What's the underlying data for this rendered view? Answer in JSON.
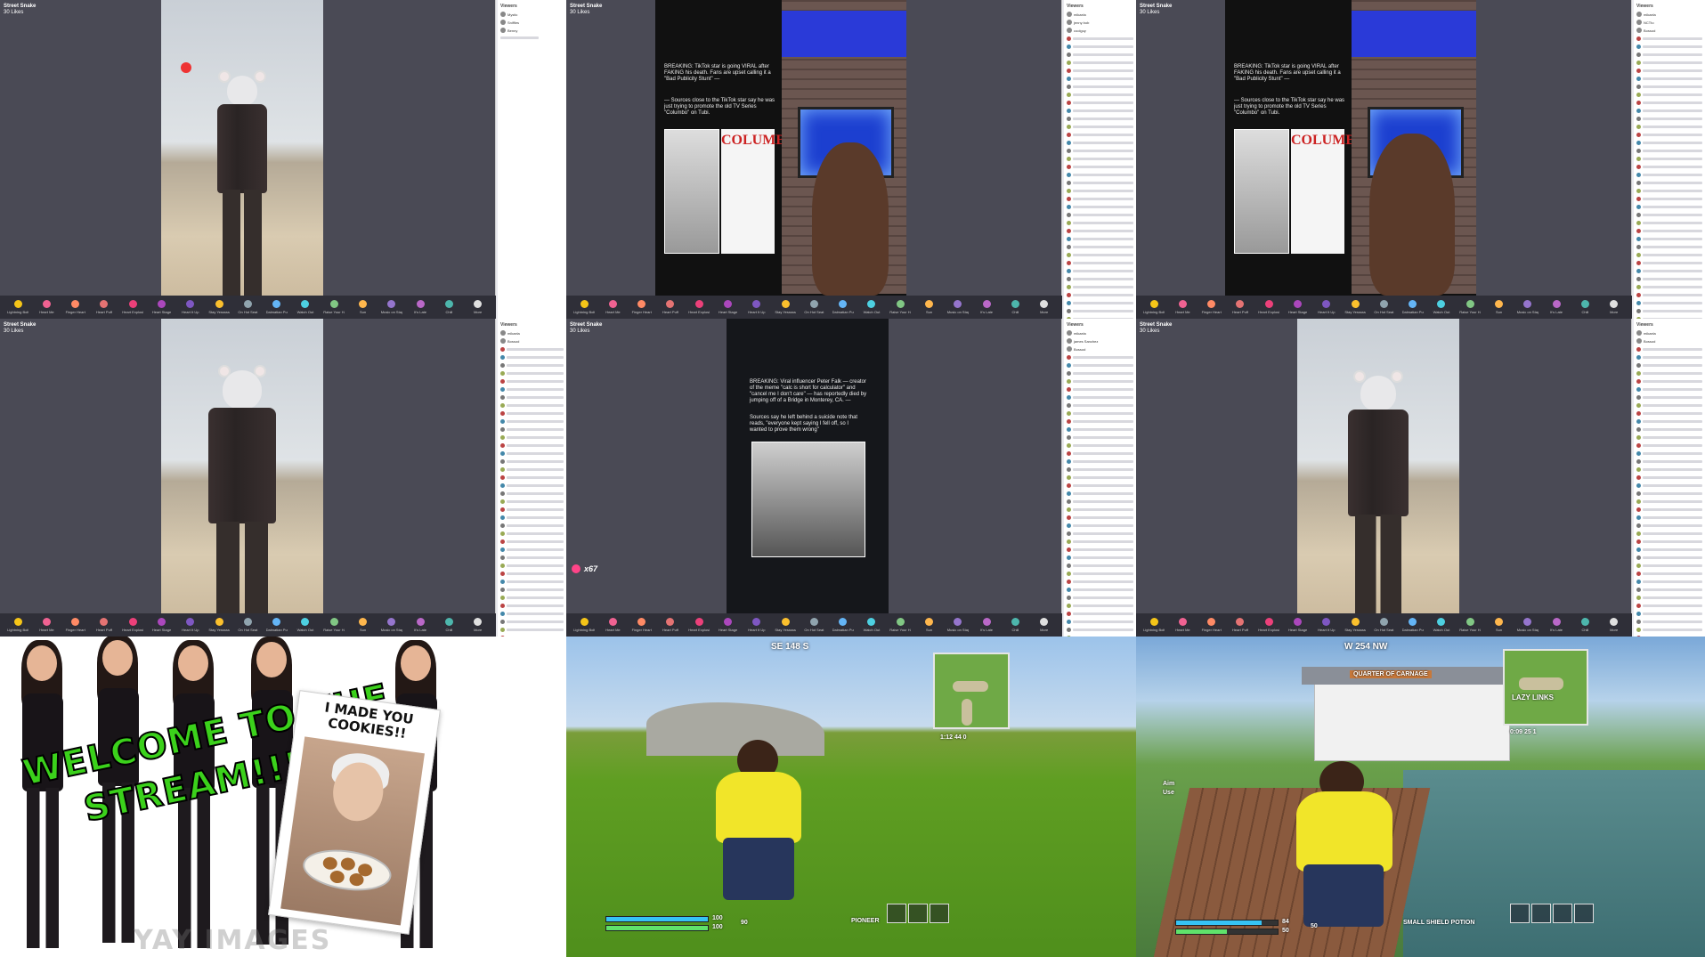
{
  "live_host": {
    "name": "Street Snake",
    "sub": "30 Likes"
  },
  "gifts": [
    "Lightning Bolt",
    "Heart Me",
    "Finger Heart",
    "Heart Puff",
    "Heart Explosion",
    "Heart Stage",
    "Heart It Up",
    "Stay Yesssss",
    "On Hot Seat",
    "Dalmatian Puff",
    "Watch Out",
    "Raise Your Hand",
    "Sun",
    "Music on Stage",
    "It's Late",
    "Chill",
    "More"
  ],
  "viewers": {
    "label": "Viewers",
    "panel1": [
      "Mystic",
      "Sniffles",
      "Benny"
    ],
    "panel2": [
      "mikaela",
      "jenny bob",
      "coolguy"
    ],
    "panel3": [
      "mikaela",
      "NCTto",
      "Bossod"
    ],
    "panel4": [
      "mikaela",
      "Bossod"
    ],
    "panel5": [
      "mikaela",
      "james Sanchez",
      "Bossod"
    ],
    "panel6": [
      "mikaela",
      "Bossod"
    ]
  },
  "news": {
    "headline": "BREAKING: TikTok star is going VIRAL after FAKING his death. Fans are upset calling it a \"Bad Publicity Stunt\" —",
    "body": "— Sources close to the TikTok star say he was just trying to promote the old TV Series \"Columbo\" on Tubi.",
    "columbo": "COLUMBO"
  },
  "news2": {
    "headline": "BREAKING: Viral influencer Peter Falk — creator of the meme \"calc is short for calculator\" and \"cancel me I don't care\" — has reportedly died by jumping off of a Bridge in Monterey, CA. —",
    "body": "Sources say he left behind a suicide note that reads, \"everyone kept saying I fell off, so I wanted to prove them wrong\"",
    "combo": "x67"
  },
  "welcome": {
    "line1": "WELCOME TO THE",
    "line2": "STREAM!!!!!",
    "card": "I MADE YOU COOKIES!!",
    "watermark": "YAY IMAGES"
  },
  "fortnite1": {
    "compass": "SE  148  S",
    "health": "100",
    "shield": "100",
    "mats": "90",
    "location": "PIONEER",
    "stats": "1:12  44  0"
  },
  "fortnite2": {
    "compass": "W  254  NW",
    "banner": "QUARTER OF CARNAGE",
    "map_label": "LAZY LINKS",
    "stats": "0:09  25  1",
    "health": "50",
    "shield": "84",
    "mats": "50",
    "location": "SMALL SHIELD POTION",
    "aim": "Aim",
    "use": "Use"
  }
}
